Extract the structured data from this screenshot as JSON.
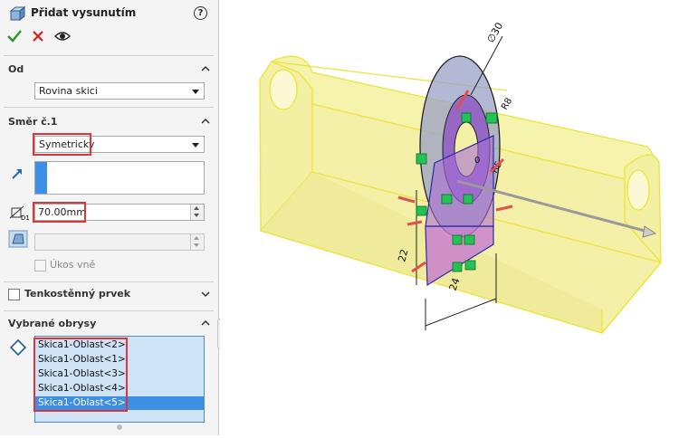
{
  "panel": {
    "title": "Přidat vysunutím",
    "help": "?",
    "icons": {
      "feature": "extrude-feature-icon",
      "ok": "checkmark-icon",
      "cancel": "close-icon",
      "preview": "eye-icon"
    }
  },
  "od": {
    "title": "Od",
    "value": "Rovina skici"
  },
  "smer1": {
    "title": "Směr č.1",
    "end_condition": "Symetricky",
    "depth": "70.00mm",
    "draft_label": "Úkos vně"
  },
  "thin": {
    "title": "Tenkostěnný prvek"
  },
  "contours": {
    "title": "Vybrané obrysy",
    "items": [
      "Skica1-Oblast<2>",
      "Skica1-Oblast<1>",
      "Skica1-Oblast<3>",
      "Skica1-Oblast<4>",
      "Skica1-Oblast<5>"
    ],
    "selected_index": 4
  },
  "model": {
    "dimensions": [
      "∅30",
      "R8",
      "R5",
      "22",
      "24",
      "0"
    ],
    "colors": {
      "body_fill": "#f4f1a6",
      "body_edge": "#eeea3a",
      "preview_fill": "#b5a1d8",
      "arrow": "#e05050",
      "handle": "#22c255"
    }
  }
}
